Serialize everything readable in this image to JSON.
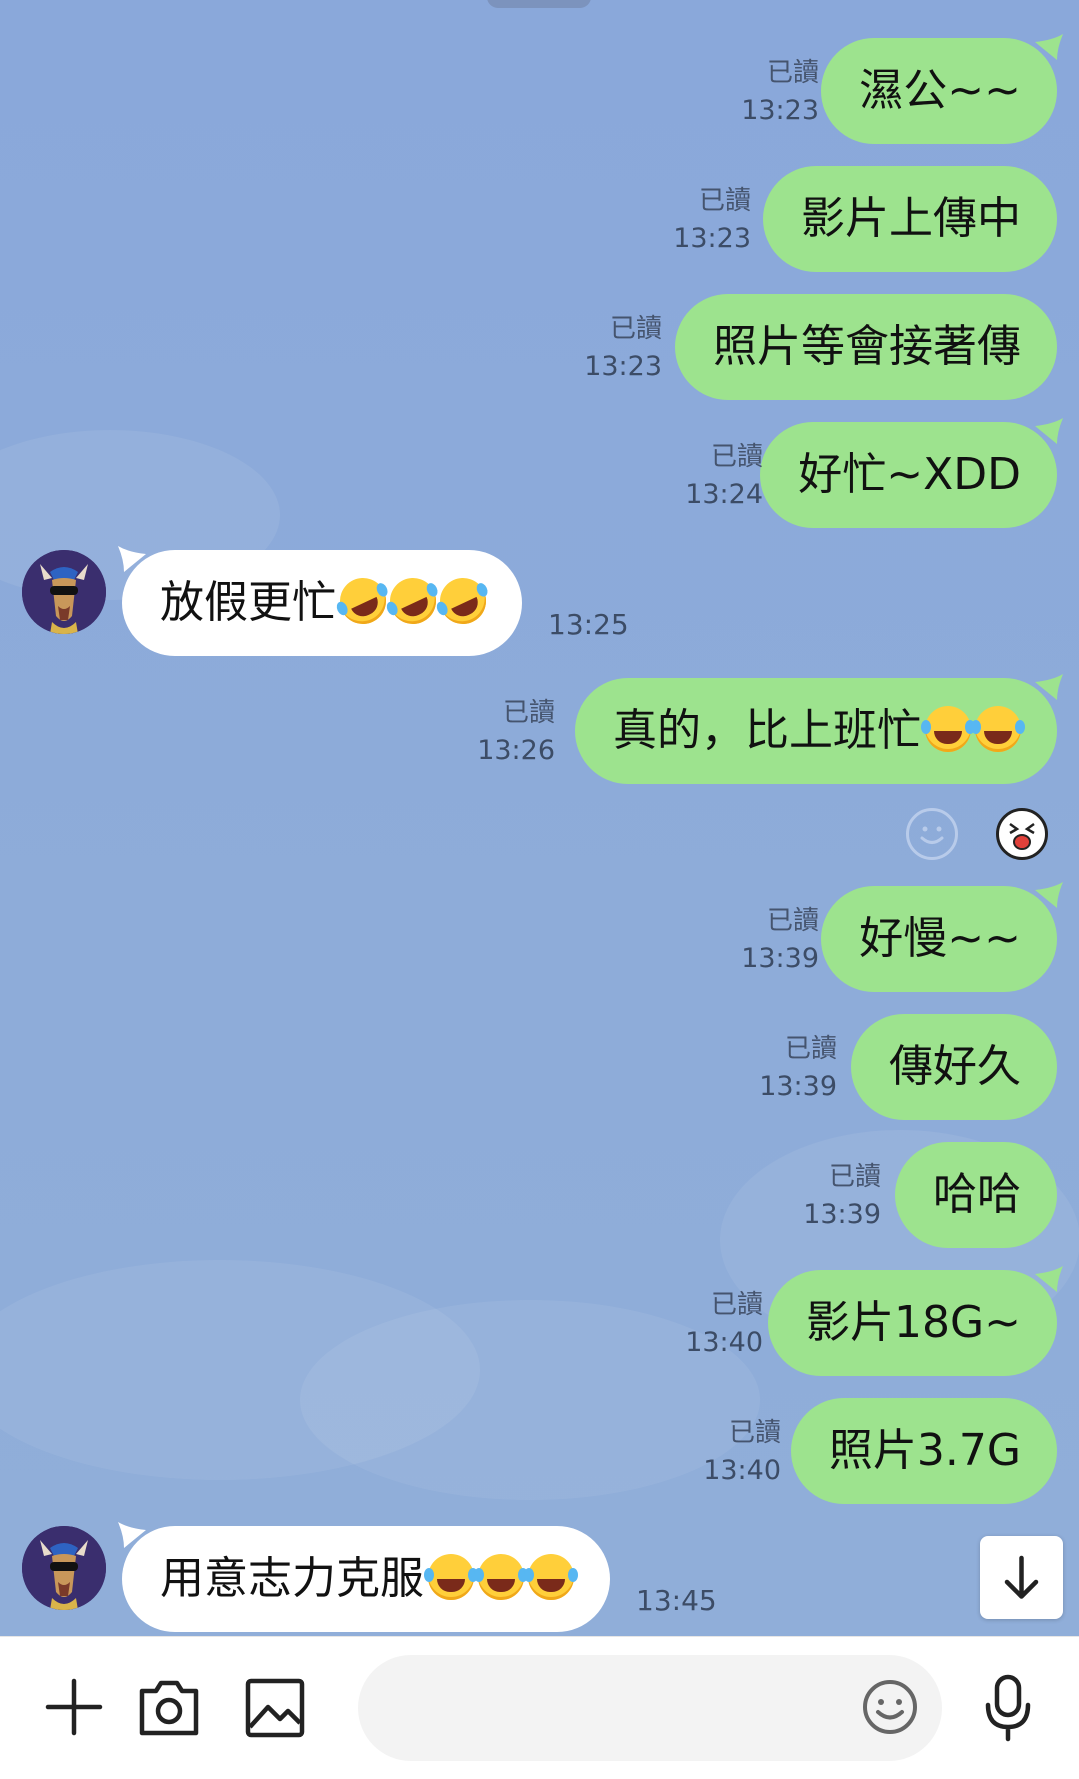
{
  "messages": [
    {
      "dir": "out",
      "text": "濕公~~",
      "read": "已讀",
      "time": "13:23"
    },
    {
      "dir": "out",
      "text": "影片上傳中",
      "read": "已讀",
      "time": "13:23"
    },
    {
      "dir": "out",
      "text": "照片等會接著傳",
      "read": "已讀",
      "time": "13:23"
    },
    {
      "dir": "out",
      "text": "好忙~XDD",
      "read": "已讀",
      "time": "13:24"
    },
    {
      "dir": "in",
      "text": "放假更忙",
      "emoji": "rolling-on-floor-laughing ×3",
      "time": "13:25"
    },
    {
      "dir": "out",
      "text": "真的，比上班忙",
      "emoji": "tears-of-joy ×2",
      "read": "已讀",
      "time": "13:26"
    },
    {
      "dir": "out",
      "text": "好慢~~",
      "read": "已讀",
      "time": "13:39"
    },
    {
      "dir": "out",
      "text": "傳好久",
      "read": "已讀",
      "time": "13:39"
    },
    {
      "dir": "out",
      "text": "哈哈",
      "read": "已讀",
      "time": "13:39"
    },
    {
      "dir": "out",
      "text": "影片18G~",
      "read": "已讀",
      "time": "13:40"
    },
    {
      "dir": "out",
      "text": "照片3.7G",
      "read": "已讀",
      "time": "13:40"
    },
    {
      "dir": "in",
      "text": "用意志力克服",
      "emoji": "tears-of-joy ×3",
      "time": "13:45"
    }
  ],
  "icons": {
    "add": "plus-icon",
    "camera": "camera-icon",
    "image": "image-icon",
    "emoji": "smiley-icon",
    "mic": "microphone-icon",
    "scroll": "arrow-down-icon",
    "react_add": "add-reaction-icon",
    "react_sticker": "sticker-face-icon"
  },
  "colors": {
    "chat_bg": "#8eacd9",
    "bubble_out": "#9de38e",
    "bubble_in": "#ffffff",
    "meta_text": "#3c4c66"
  }
}
